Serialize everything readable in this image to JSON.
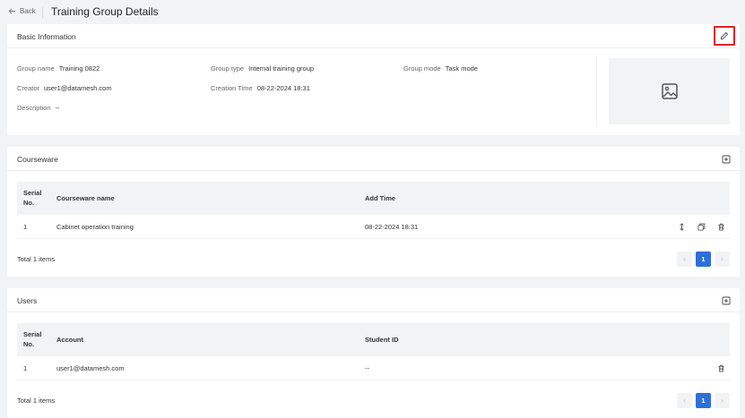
{
  "header": {
    "back_label": "Back",
    "title": "Training Group Details"
  },
  "basic_info": {
    "title": "Basic Information",
    "edit_icon": "pencil-icon",
    "fields": {
      "group_name": {
        "label": "Group name",
        "value": "Training 0822"
      },
      "group_type": {
        "label": "Group type",
        "value": "Internal training group"
      },
      "group_mode": {
        "label": "Group mode",
        "value": "Task mode"
      },
      "creator": {
        "label": "Creator",
        "value": "user1@datamesh.com"
      },
      "creation_time": {
        "label": "Creation Time",
        "value": "08-22-2024 18:31"
      },
      "description": {
        "label": "Description",
        "value": "--"
      }
    },
    "image_icon": "image-placeholder-icon"
  },
  "courseware": {
    "title": "Courseware",
    "columns": [
      "Serial No.",
      "Courseware name",
      "Add Time"
    ],
    "rows": [
      {
        "serial": "1",
        "name": "Cabinet operation training",
        "add_time": "08-22-2024 18:31"
      }
    ],
    "total": "Total 1 items",
    "page": "1"
  },
  "users": {
    "title": "Users",
    "columns": [
      "Serial No.",
      "Account",
      "Student ID"
    ],
    "rows": [
      {
        "serial": "1",
        "account": "user1@datamesh.com",
        "student_id": "--"
      }
    ],
    "total": "Total 1 items",
    "page": "1"
  },
  "colors": {
    "accent": "#2f6fd8",
    "highlight": "#e02424",
    "background": "#f2f3f5"
  }
}
